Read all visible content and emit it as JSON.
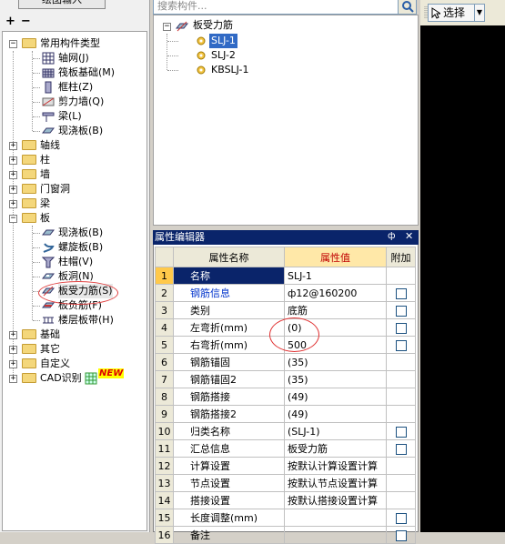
{
  "left_panel": {
    "tab_label": "绘图输入",
    "add_icon": "+",
    "remove_icon": "−",
    "tree": [
      {
        "label": "常用构件类型",
        "children": [
          "轴网(J)",
          "筏板基础(M)",
          "框柱(Z)",
          "剪力墙(Q)",
          "梁(L)",
          "现浇板(B)"
        ]
      },
      {
        "label": "轴线"
      },
      {
        "label": "柱"
      },
      {
        "label": "墙"
      },
      {
        "label": "门窗洞"
      },
      {
        "label": "梁"
      },
      {
        "label": "板",
        "children": [
          "现浇板(B)",
          "螺旋板(B)",
          "柱帽(V)",
          "板洞(N)",
          "板受力筋(S)",
          "板负筋(F)",
          "楼层板带(H)"
        ]
      },
      {
        "label": "基础"
      },
      {
        "label": "其它"
      },
      {
        "label": "自定义"
      },
      {
        "label": "CAD识别",
        "badge": "NEW"
      }
    ]
  },
  "search": {
    "placeholder": "搜索构件..."
  },
  "component_tree": {
    "root": "板受力筋",
    "items": [
      "SLJ-1",
      "SLJ-2",
      "KBSLJ-1"
    ]
  },
  "toolbar": {
    "select_label": "选择"
  },
  "property_editor": {
    "title": "属性编辑器",
    "headers": {
      "num": "",
      "name": "属性名称",
      "value": "属性值",
      "extra": "附加"
    },
    "rows": [
      {
        "n": "1",
        "name": "名称",
        "value": "SLJ-1",
        "check": false
      },
      {
        "n": "2",
        "name": "钢筋信息",
        "value": "ф12@160200",
        "check": true
      },
      {
        "n": "3",
        "name": "类别",
        "value": "底筋",
        "check": true
      },
      {
        "n": "4",
        "name": "左弯折(mm)",
        "value": "(0)",
        "check": true
      },
      {
        "n": "5",
        "name": "右弯折(mm)",
        "value": "500",
        "check": true
      },
      {
        "n": "6",
        "name": "钢筋锚固",
        "value": "(35)",
        "check": false
      },
      {
        "n": "7",
        "name": "钢筋锚固2",
        "value": "(35)",
        "check": false
      },
      {
        "n": "8",
        "name": "钢筋搭接",
        "value": "(49)",
        "check": false
      },
      {
        "n": "9",
        "name": "钢筋搭接2",
        "value": "(49)",
        "check": false
      },
      {
        "n": "10",
        "name": "归类名称",
        "value": "(SLJ-1)",
        "check": true
      },
      {
        "n": "11",
        "name": "汇总信息",
        "value": "板受力筋",
        "check": true
      },
      {
        "n": "12",
        "name": "计算设置",
        "value": "按默认计算设置计算",
        "check": false
      },
      {
        "n": "13",
        "name": "节点设置",
        "value": "按默认节点设置计算",
        "check": false
      },
      {
        "n": "14",
        "name": "搭接设置",
        "value": "按默认搭接设置计算",
        "check": false
      },
      {
        "n": "15",
        "name": "长度调整(mm)",
        "value": "",
        "check": true
      },
      {
        "n": "16",
        "name": "备注",
        "value": "",
        "check": true
      }
    ]
  },
  "colors": {
    "title_bar": "#0a246a",
    "header_value": "#ffe8a8",
    "selected": "#316ac5",
    "annotation": "#e03030"
  }
}
